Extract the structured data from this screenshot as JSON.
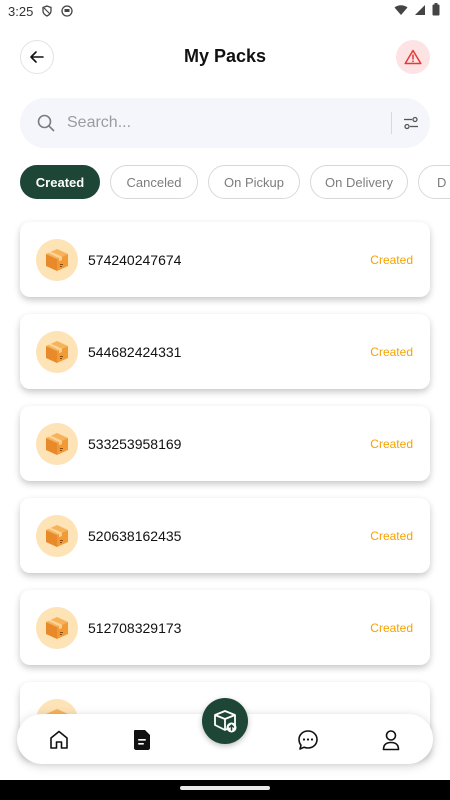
{
  "status_bar": {
    "time": "3:25"
  },
  "header": {
    "title": "My Packs"
  },
  "search": {
    "placeholder": "Search..."
  },
  "filters": [
    {
      "label": "Created",
      "active": true
    },
    {
      "label": "Canceled",
      "active": false
    },
    {
      "label": "On Pickup",
      "active": false
    },
    {
      "label": "On Delivery",
      "active": false
    },
    {
      "label": "D",
      "active": false
    }
  ],
  "packs": [
    {
      "number": "574240247674",
      "status": "Created"
    },
    {
      "number": "544682424331",
      "status": "Created"
    },
    {
      "number": "533253958169",
      "status": "Created"
    },
    {
      "number": "520638162435",
      "status": "Created"
    },
    {
      "number": "512708329173",
      "status": "Created"
    },
    {
      "number": "",
      "status": ""
    }
  ],
  "bottom_nav": [
    "home-icon",
    "document-icon",
    "add-pack-icon",
    "chat-icon",
    "profile-icon"
  ],
  "colors": {
    "primary": "#1d4636",
    "status": "#f5a300",
    "alert_bg": "#fde3e3",
    "box_bg": "#fde3b6"
  }
}
